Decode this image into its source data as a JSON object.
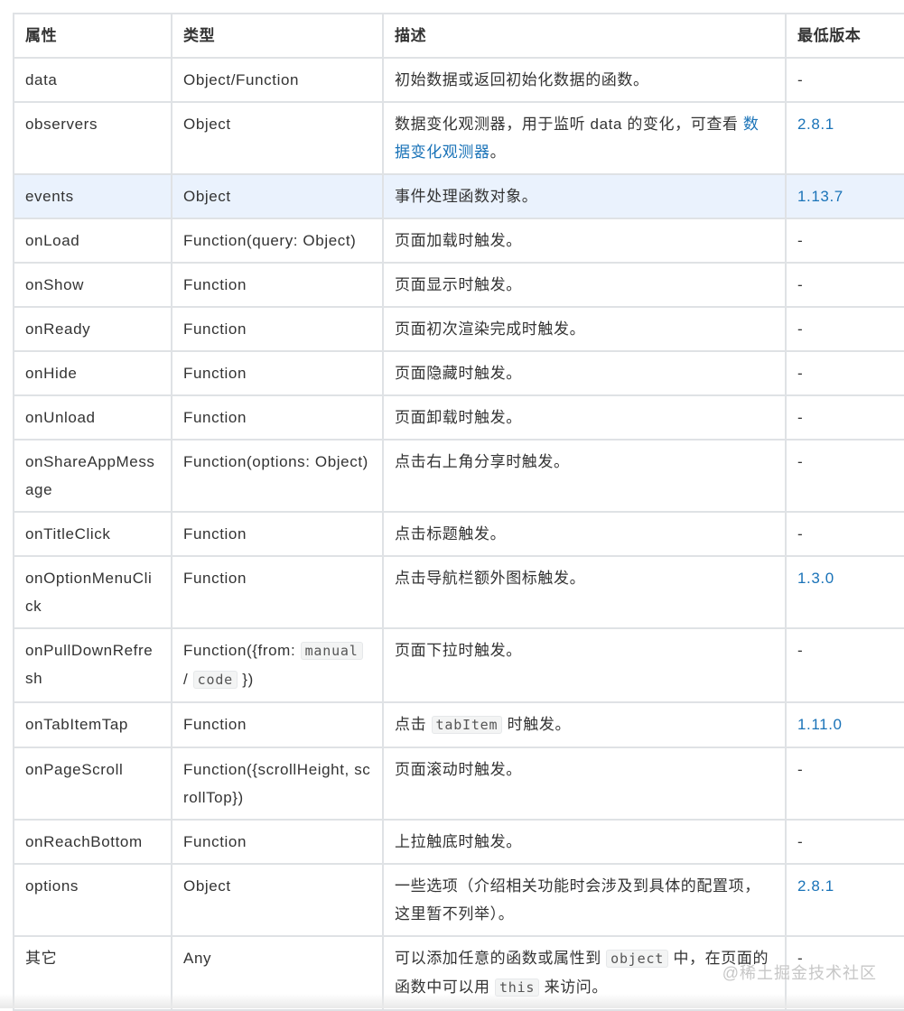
{
  "headers": [
    "属性",
    "类型",
    "描述",
    "最低版本"
  ],
  "rows": [
    {
      "name": "data",
      "type": "Object/Function",
      "desc": "初始数据或返回初始化数据的函数。",
      "version": "-"
    },
    {
      "name": "observers",
      "type": "Object",
      "desc": "数据变化观测器，用于监听 data 的变化，可查看",
      "desc_link": "数据变化观测器",
      "desc_after": "。",
      "version": "2.8.1"
    },
    {
      "name": "events",
      "type": "Object",
      "desc": "事件处理函数对象。",
      "version": "1.13.7",
      "highlighted": true
    },
    {
      "name": "onLoad",
      "type": "Function(query: Object)",
      "desc": "页面加载时触发。",
      "version": "-"
    },
    {
      "name": "onShow",
      "type": "Function",
      "desc": "页面显示时触发。",
      "version": "-"
    },
    {
      "name": "onReady",
      "type": "Function",
      "desc": "页面初次渲染完成时触发。",
      "version": "-"
    },
    {
      "name": "onHide",
      "type": "Function",
      "desc": "页面隐藏时触发。",
      "version": "-"
    },
    {
      "name": "onUnload",
      "type": "Function",
      "desc": "页面卸载时触发。",
      "version": "-"
    },
    {
      "name": "onShareAppMessage",
      "type": "Function(options: Object)",
      "desc": "点击右上角分享时触发。",
      "version": "-"
    },
    {
      "name": "onTitleClick",
      "type": "Function",
      "desc": "点击标题触发。",
      "version": "-"
    },
    {
      "name": "onOptionMenuClick",
      "type": "Function",
      "desc": "点击导航栏额外图标触发。",
      "version": "1.3.0"
    },
    {
      "name": "onPullDownRefresh",
      "type": "Function({from: ",
      "type_code1": "manual",
      "type_sep": " / ",
      "type_code2": "code",
      "type_after": " })",
      "desc": "页面下拉时触发。",
      "version": "-"
    },
    {
      "name": "onTabItemTap",
      "type": "Function",
      "desc": "点击 ",
      "desc_code": "tabItem",
      "desc_after": " 时触发。",
      "version": "1.11.0"
    },
    {
      "name": "onPageScroll",
      "type": "Function({scrollHeight, scrollTop})",
      "desc": "页面滚动时触发。",
      "version": "-"
    },
    {
      "name": "onReachBottom",
      "type": "Function",
      "desc": "上拉触底时触发。",
      "version": "-"
    },
    {
      "name": "options",
      "type": "Object",
      "desc": "一些选项（介绍相关功能时会涉及到具体的配置项，这里暂不列举）。",
      "version": "2.8.1"
    },
    {
      "name": "其它",
      "type": "Any",
      "desc": "可以添加任意的函数或属性到 ",
      "desc_code": "object",
      "desc_after": " 中，在页面的函数中可以用 ",
      "desc_code2": "this",
      "desc_after2": " 来访问。",
      "version": "-"
    }
  ],
  "watermark": "@稀土掘金技术社区",
  "colors": {
    "link": "#1a73b8",
    "highlight_row": "#eaf2fd",
    "border": "#dfe2e5"
  }
}
